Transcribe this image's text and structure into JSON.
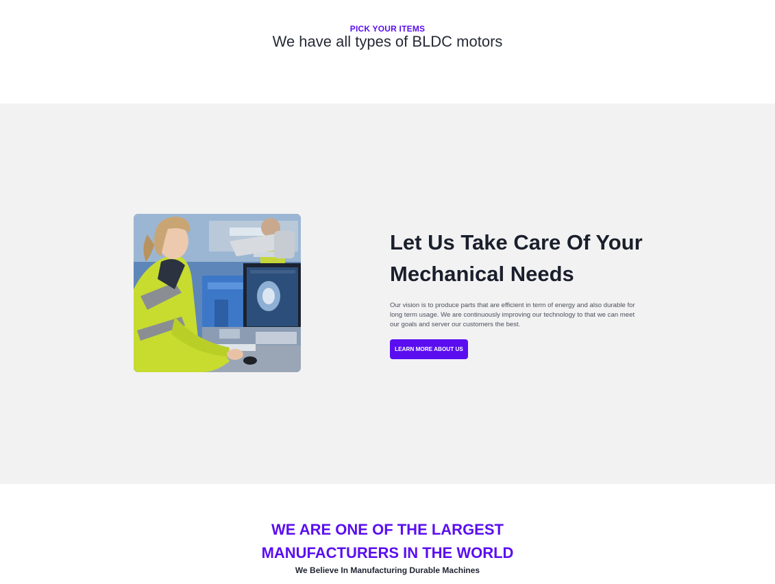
{
  "header": {
    "eyebrow": "PICK YOUR ITEMS",
    "title": "We have all types of BLDC motors"
  },
  "about": {
    "image": "engineer-at-computer-photo",
    "heading_line1": "Let Us Take Care Of Your",
    "heading_line2": "Mechanical Needs",
    "description": "Our vision is to produce parts that are efficient in term of energy and also durable for long term usage. We are continuously improving our technology to that we can meet our goals and server our customers the best.",
    "button_label": "LEARN MORE ABOUT US"
  },
  "stats": {
    "title_line1": "WE ARE ONE OF THE LARGEST",
    "title_line2": "MANUFACTURERS IN THE WORLD",
    "subtitle": "We Believe In Manufacturing Durable Machines"
  },
  "colors": {
    "accent": "#5a0ef0",
    "section_bg": "#f2f2f3",
    "heading": "#1a1f2c"
  }
}
